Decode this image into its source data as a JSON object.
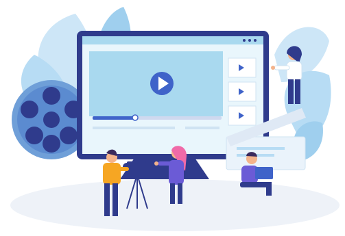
{
  "illustration": {
    "subject": "video-production",
    "colors": {
      "monitor_frame": "#2f3b8c",
      "screen_bg": "#cfeaf6",
      "screen_inner": "#a9d9ef",
      "accent_blue": "#3f63c9",
      "leaf_light": "#cde6f7",
      "leaf_mid": "#9fcfee",
      "reel": "#6f9fd8",
      "floor": "#eef2f8",
      "skin": "#f4b38b",
      "orange": "#f6a623",
      "pink": "#f06aa8",
      "purple": "#6b5bd6"
    },
    "player": {
      "play_icon": "play-icon",
      "progress": 0.33
    },
    "thumbnails_count": 3,
    "people": [
      {
        "role": "camera-operator"
      },
      {
        "role": "presenter"
      },
      {
        "role": "laptop-user"
      },
      {
        "role": "clapper-rider"
      }
    ]
  }
}
